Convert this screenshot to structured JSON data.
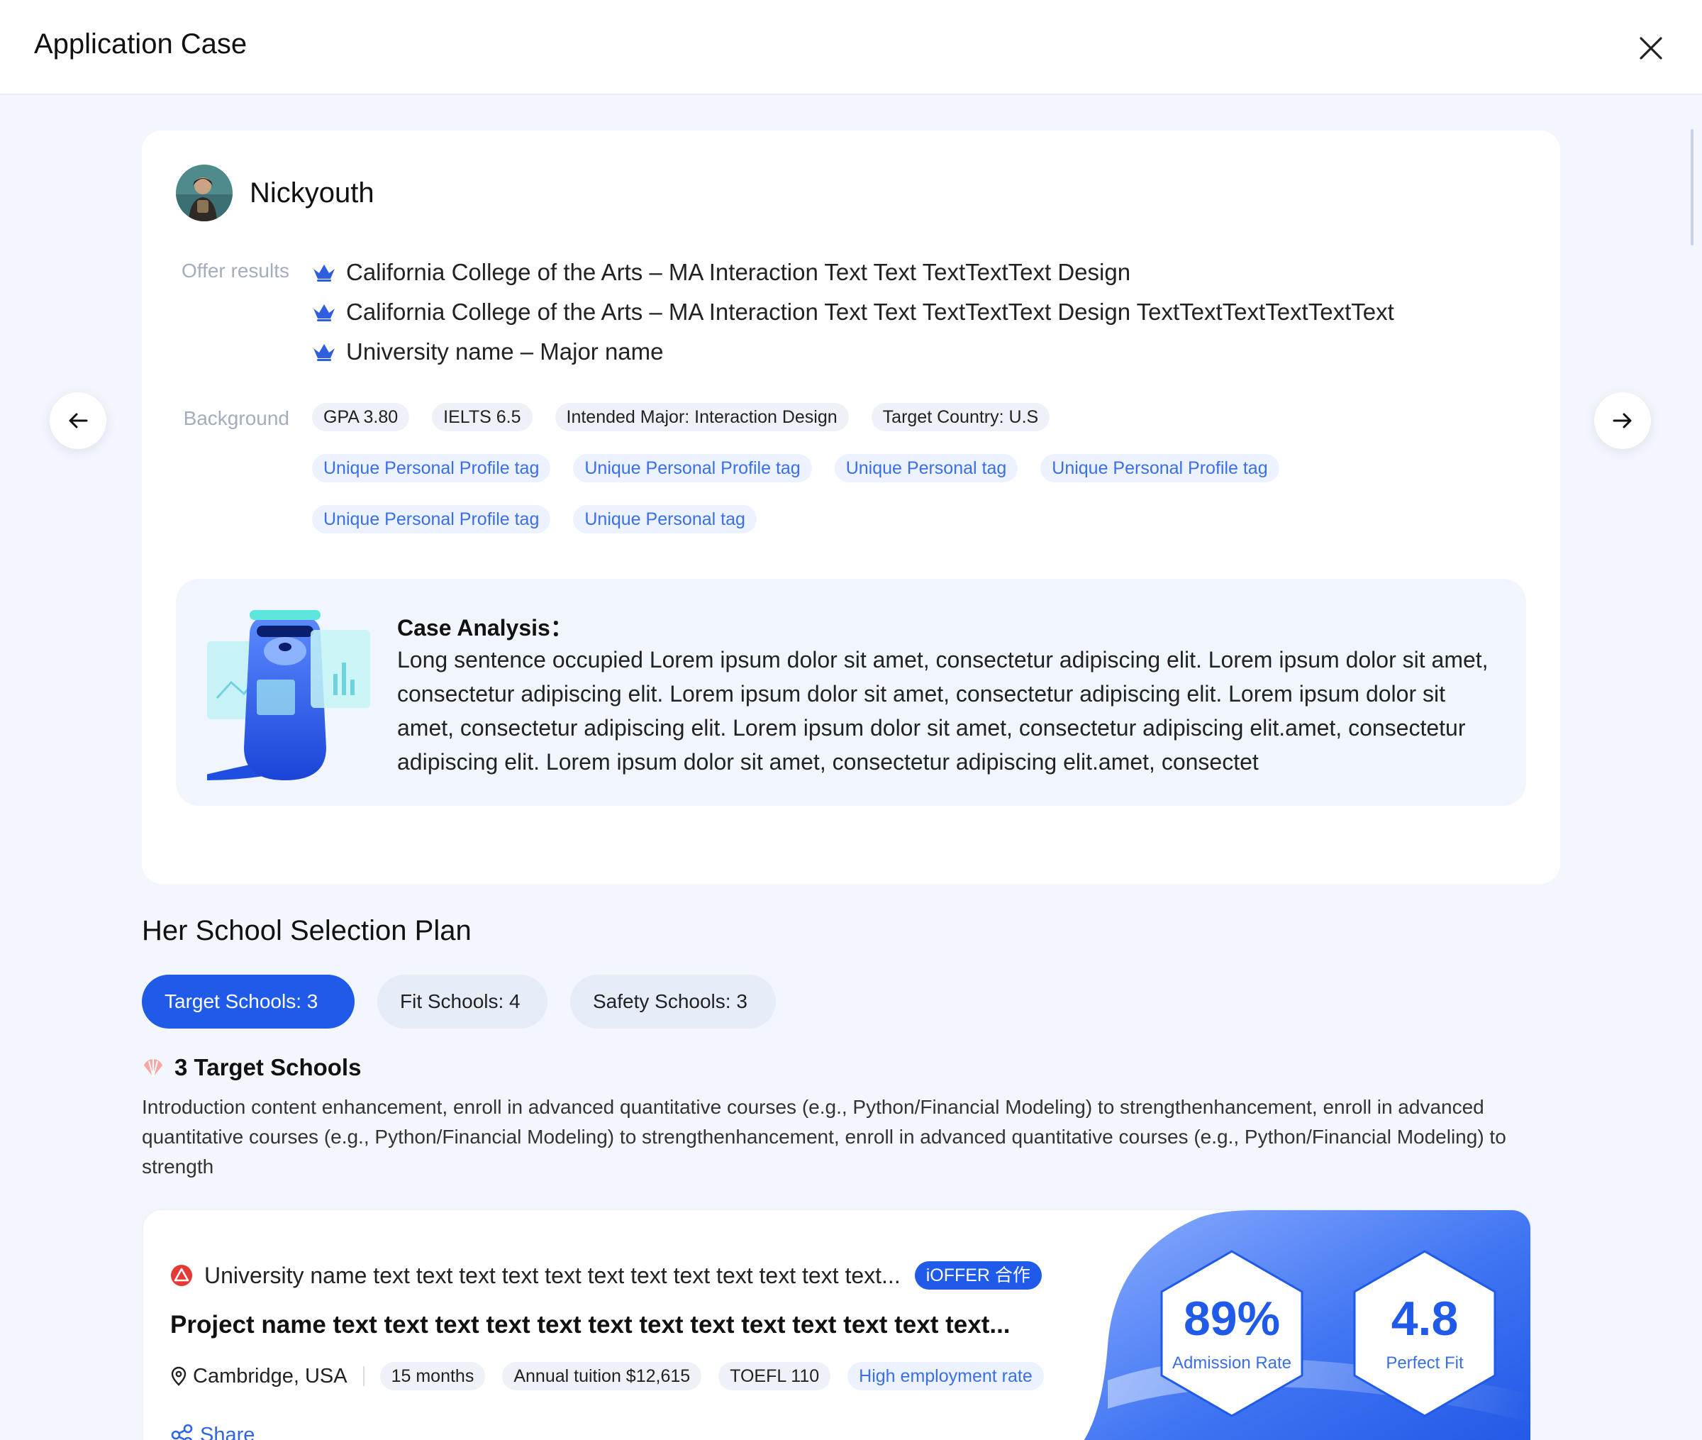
{
  "modal": {
    "title": "Application Case"
  },
  "profile": {
    "name": "Nickyouth",
    "offers_label": "Offer results",
    "offers": [
      "California College of the Arts – MA Interaction Text Text TextTextText Design",
      "California College of the Arts – MA Interaction Text Text TextTextText Design TextTextTextTextTextText",
      "University name – Major name"
    ],
    "background_label": "Background",
    "stats_tags": [
      "GPA 3.80",
      "IELTS 6.5",
      "Intended Major: Interaction Design",
      "Target Country: U.S"
    ],
    "profile_tags_row1": [
      "Unique Personal Profile tag",
      "Unique Personal Profile tag",
      "Unique Personal tag",
      "Unique Personal Profile tag"
    ],
    "profile_tags_row2": [
      "Unique Personal Profile tag",
      "Unique Personal tag"
    ]
  },
  "analysis": {
    "title": "Case Analysis：",
    "text": "Long sentence occupied Lorem ipsum dolor sit amet, consectetur adipiscing elit. Lorem ipsum dolor sit amet, consectetur adipiscing elit. Lorem ipsum dolor sit amet, consectetur adipiscing elit. Lorem ipsum dolor sit amet, consectetur adipiscing elit. Lorem ipsum dolor sit amet, consectetur adipiscing elit.amet, consectetur adipiscing elit. Lorem ipsum dolor sit amet, consectetur adipiscing elit.amet, consectet"
  },
  "plan": {
    "title": "Her School Selection Plan",
    "tabs": [
      "Target Schools: 3",
      "Fit Schools: 4",
      "Safety Schools: 3"
    ],
    "active_tab": 0,
    "subheading": "3 Target Schools",
    "intro": "Introduction content  enhancement, enroll in advanced quantitative courses (e.g., Python/Financial Modeling) to strengthenhancement, enroll in advanced quantitative courses (e.g., Python/Financial Modeling) to strengthenhancement, enroll in advanced quantitative courses (e.g., Python/Financial Modeling) to strength"
  },
  "school_card": {
    "university": "University name text text text text text text text text text text text text...",
    "partner_badge": "iOFFER 合作",
    "project": "Project name text text text text text text text text text text text text text...",
    "location": "Cambridge, USA",
    "tags": [
      "15 months",
      "Annual tuition $12,615",
      "TOEFL 110"
    ],
    "highlight_tag": "High employment rate",
    "share": "Share",
    "admission_value": "89%",
    "admission_label": "Admission Rate",
    "fit_value": "4.8",
    "fit_label": "Perfect Fit"
  },
  "colors": {
    "primary": "#1f5ae8",
    "tag_blue_text": "#3a6fe6",
    "page_bg": "#f3f6fc"
  },
  "icons": {
    "close": "close-icon",
    "prev": "arrow-left-icon",
    "next": "arrow-right-icon",
    "offer": "crown-icon",
    "share": "share-icon",
    "location": "location-pin-icon"
  }
}
